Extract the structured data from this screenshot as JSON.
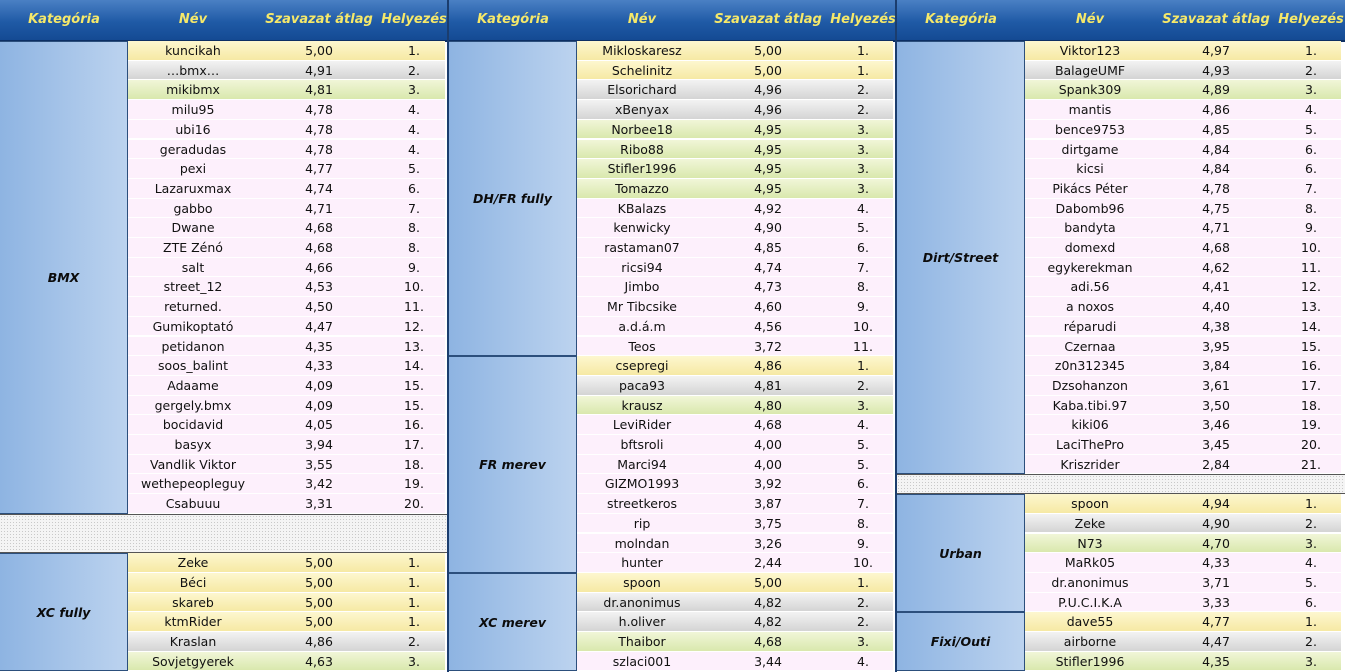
{
  "headers": {
    "category": "Kategória",
    "name": "Név",
    "avg": "Szavazat átlag",
    "rank": "Helyezés"
  },
  "panels": [
    {
      "groups": [
        {
          "category": "BMX",
          "rows": [
            [
              "kuncikah",
              "5,00",
              "1."
            ],
            [
              "…bmx…",
              "4,91",
              "2."
            ],
            [
              "mikibmx",
              "4,81",
              "3."
            ],
            [
              "milu95",
              "4,78",
              "4."
            ],
            [
              "ubi16",
              "4,78",
              "4."
            ],
            [
              "geradudas",
              "4,78",
              "4."
            ],
            [
              "pexi",
              "4,77",
              "5."
            ],
            [
              "Lazaruxmax",
              "4,74",
              "6."
            ],
            [
              "gabbo",
              "4,71",
              "7."
            ],
            [
              "Dwane",
              "4,68",
              "8."
            ],
            [
              "ZTE Zénó",
              "4,68",
              "8."
            ],
            [
              "salt",
              "4,66",
              "9."
            ],
            [
              "street_12",
              "4,53",
              "10."
            ],
            [
              "returned.",
              "4,50",
              "11."
            ],
            [
              "Gumikoptató",
              "4,47",
              "12."
            ],
            [
              "petidanon",
              "4,35",
              "13."
            ],
            [
              "soos_balint",
              "4,33",
              "14."
            ],
            [
              "Adaame",
              "4,09",
              "15."
            ],
            [
              "gergely.bmx",
              "4,09",
              "15."
            ],
            [
              "bocidavid",
              "4,05",
              "16."
            ],
            [
              "basyx",
              "3,94",
              "17."
            ],
            [
              "Vandlik Viktor",
              "3,55",
              "18."
            ],
            [
              "wethepeopleguy",
              "3,42",
              "19."
            ],
            [
              "Csabuuu",
              "3,31",
              "20."
            ]
          ]
        },
        {
          "gap": 2
        },
        {
          "category": "XC fully",
          "rows": [
            [
              "Zeke",
              "5,00",
              "1."
            ],
            [
              "Béci",
              "5,00",
              "1."
            ],
            [
              "skareb",
              "5,00",
              "1."
            ],
            [
              "ktmRider",
              "5,00",
              "1."
            ],
            [
              "Kraslan",
              "4,86",
              "2."
            ],
            [
              "Sovjetgyerek",
              "4,63",
              "3."
            ]
          ]
        }
      ]
    },
    {
      "groups": [
        {
          "category": "DH/FR fully",
          "rows": [
            [
              "Mikloskaresz",
              "5,00",
              "1."
            ],
            [
              "Schelinitz",
              "5,00",
              "1."
            ],
            [
              "Elsorichard",
              "4,96",
              "2."
            ],
            [
              "xBenyax",
              "4,96",
              "2."
            ],
            [
              "Norbee18",
              "4,95",
              "3."
            ],
            [
              "Ribo88",
              "4,95",
              "3."
            ],
            [
              "Stifler1996",
              "4,95",
              "3."
            ],
            [
              "Tomazzo",
              "4,95",
              "3."
            ],
            [
              "KBalazs",
              "4,92",
              "4."
            ],
            [
              "kenwicky",
              "4,90",
              "5."
            ],
            [
              "rastaman07",
              "4,85",
              "6."
            ],
            [
              "ricsi94",
              "4,74",
              "7."
            ],
            [
              "Jimbo",
              "4,73",
              "8."
            ],
            [
              "Mr Tibcsike",
              "4,60",
              "9."
            ],
            [
              "a.d.á.m",
              "4,56",
              "10."
            ],
            [
              "Teos",
              "3,72",
              "11."
            ]
          ]
        },
        {
          "category": "FR merev",
          "rows": [
            [
              "csepregi",
              "4,86",
              "1."
            ],
            [
              "paca93",
              "4,81",
              "2."
            ],
            [
              "krausz",
              "4,80",
              "3."
            ],
            [
              "LeviRider",
              "4,68",
              "4."
            ],
            [
              "bftsroli",
              "4,00",
              "5."
            ],
            [
              "Marci94",
              "4,00",
              "5."
            ],
            [
              "GIZMO1993",
              "3,92",
              "6."
            ],
            [
              "streetkeros",
              "3,87",
              "7."
            ],
            [
              "rip",
              "3,75",
              "8."
            ],
            [
              "molndan",
              "3,26",
              "9."
            ],
            [
              "hunter",
              "2,44",
              "10."
            ]
          ]
        },
        {
          "category": "XC merev",
          "rows": [
            [
              "spoon",
              "5,00",
              "1."
            ],
            [
              "dr.anonimus",
              "4,82",
              "2."
            ],
            [
              "h.oliver",
              "4,82",
              "2."
            ],
            [
              "Thaibor",
              "4,68",
              "3."
            ],
            [
              "szlaci001",
              "3,44",
              "4."
            ]
          ]
        }
      ]
    },
    {
      "groups": [
        {
          "category": "Dirt/Street",
          "rows": [
            [
              "Viktor123",
              "4,97",
              "1."
            ],
            [
              "BalageUMF",
              "4,93",
              "2."
            ],
            [
              "Spank309",
              "4,89",
              "3."
            ],
            [
              "mantis",
              "4,86",
              "4."
            ],
            [
              "bence9753",
              "4,85",
              "5."
            ],
            [
              "dirtgame",
              "4,84",
              "6."
            ],
            [
              "kicsi",
              "4,84",
              "6."
            ],
            [
              "Pikács Péter",
              "4,78",
              "7."
            ],
            [
              "Dabomb96",
              "4,75",
              "8."
            ],
            [
              "bandyta",
              "4,71",
              "9."
            ],
            [
              "domexd",
              "4,68",
              "10."
            ],
            [
              "egykerekman",
              "4,62",
              "11."
            ],
            [
              "adi.56",
              "4,41",
              "12."
            ],
            [
              "a noxos",
              "4,40",
              "13."
            ],
            [
              "réparudi",
              "4,38",
              "14."
            ],
            [
              "Czernaa",
              "3,95",
              "15."
            ],
            [
              "z0n312345",
              "3,84",
              "16."
            ],
            [
              "Dzsohanzon",
              "3,61",
              "17."
            ],
            [
              "Kaba.tibi.97",
              "3,50",
              "18."
            ],
            [
              "kiki06",
              "3,46",
              "19."
            ],
            [
              "LaciThePro",
              "3,45",
              "20."
            ],
            [
              "Kriszrider",
              "2,84",
              "21."
            ]
          ]
        },
        {
          "gap": 1
        },
        {
          "category": "Urban",
          "rows": [
            [
              "spoon",
              "4,94",
              "1."
            ],
            [
              "Zeke",
              "4,90",
              "2."
            ],
            [
              "N73",
              "4,70",
              "3."
            ],
            [
              "MaRk05",
              "4,33",
              "4."
            ],
            [
              "dr.anonimus",
              "3,71",
              "5."
            ],
            [
              "P.U.C.I.K.A",
              "3,33",
              "6."
            ]
          ]
        },
        {
          "category": "Fixi/Outi",
          "rows": [
            [
              "dave55",
              "4,77",
              "1."
            ],
            [
              "airborne",
              "4,47",
              "2."
            ],
            [
              "Stifler1996",
              "4,35",
              "3."
            ]
          ]
        }
      ]
    }
  ]
}
